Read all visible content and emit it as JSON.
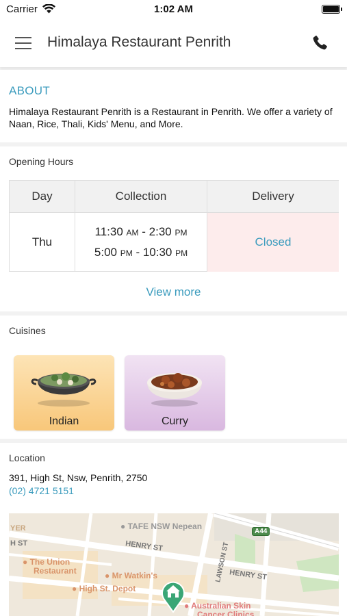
{
  "status_bar": {
    "carrier": "Carrier",
    "time": "1:02 AM"
  },
  "header": {
    "title": "Himalaya Restaurant Penrith"
  },
  "about": {
    "heading": "ABOUT",
    "text": "Himalaya Restaurant Penrith is a Restaurant in Penrith. We offer a variety of Naan, Rice, Thali, Kids' Menu, and More."
  },
  "opening_hours": {
    "label": "Opening Hours",
    "columns": [
      "Day",
      "Collection",
      "Delivery"
    ],
    "rows": [
      {
        "day": "Thu",
        "collection": [
          {
            "start": "11:30",
            "start_period": "AM",
            "separator": " - ",
            "end": "2:30",
            "end_period": "PM"
          },
          {
            "start": "5:00",
            "start_period": "PM",
            "separator": " - ",
            "end": "10:30",
            "end_period": "PM"
          }
        ],
        "delivery": "Closed"
      }
    ],
    "view_more": "View more"
  },
  "cuisines": {
    "label": "Cuisines",
    "items": [
      {
        "name": "Indian",
        "image": "kadai-bowl-image"
      },
      {
        "name": "Curry",
        "image": "curry-bowl-image"
      }
    ]
  },
  "location": {
    "label": "Location",
    "address": "391, High St, Nsw, Penrith, 2750",
    "phone": "(02) 4721 5151",
    "map": {
      "labels": {
        "tafe": "TAFE NSW Nepean",
        "union": "The Union",
        "restaurant": "Restaurant",
        "watkins": "Mr Watkin's",
        "high_st_depot": "High St. Depot",
        "skin_1": "Australian Skin",
        "skin_2": "Cancer Clinics",
        "henry_st_1": "HENRY ST",
        "henry_st_2": "HENRY ST",
        "lawson_st": "LAWSON ST",
        "a44": "A44",
        "yer": "YER",
        "h_st": "H ST"
      }
    }
  },
  "colors": {
    "accent": "#3a9bbd",
    "closed_bg": "#fdecec",
    "map_pin": "#3aa676"
  },
  "icons": [
    "menu-icon",
    "phone-icon",
    "wifi-icon",
    "battery-icon",
    "map-pin-icon",
    "home-icon"
  ]
}
